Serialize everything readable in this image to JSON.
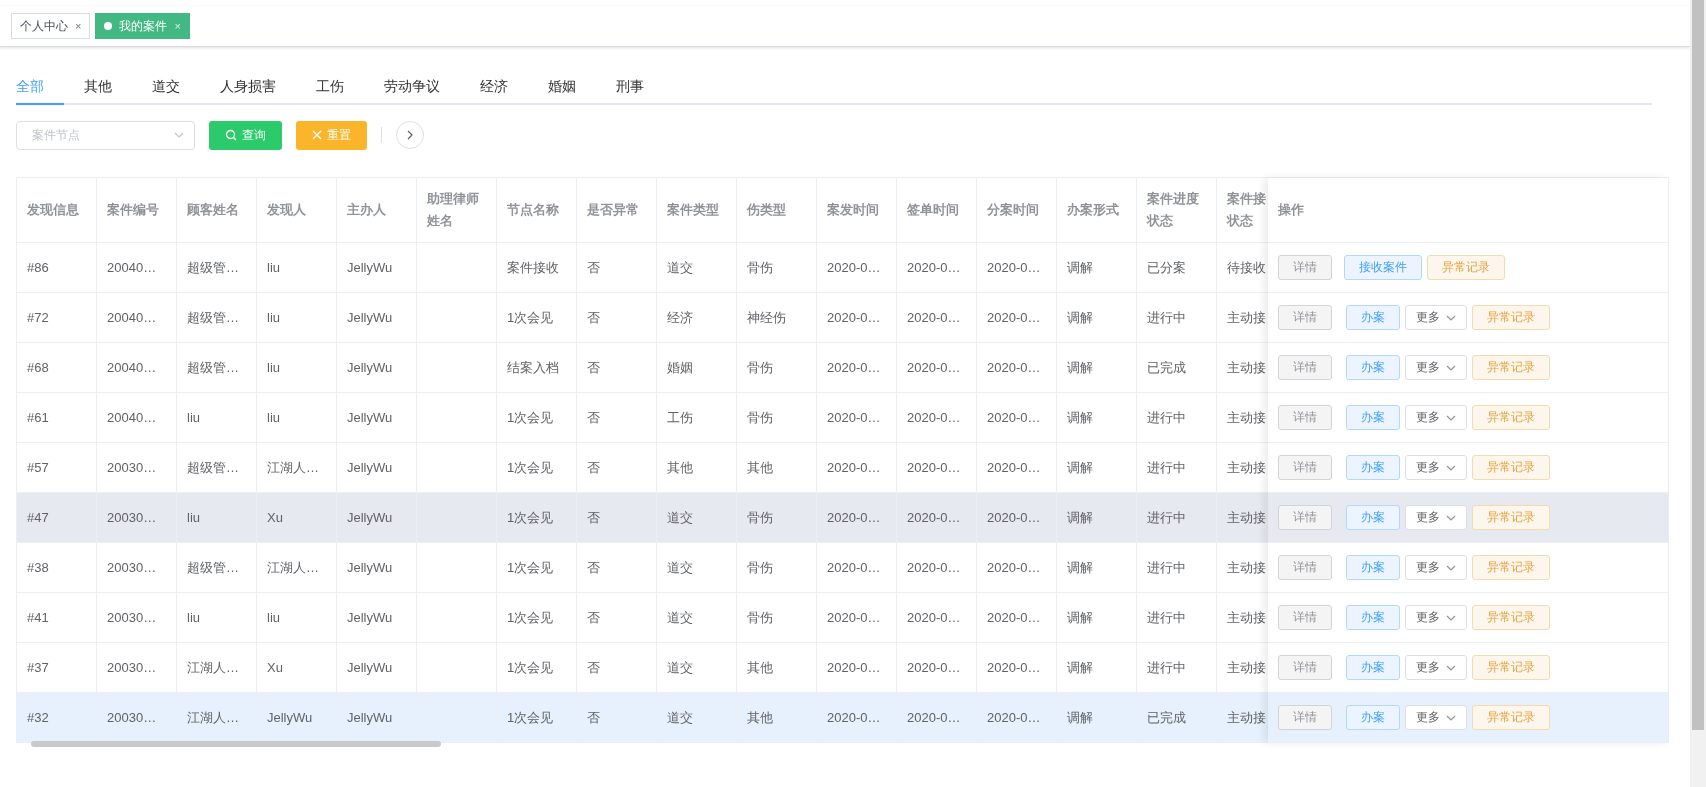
{
  "page_tags": [
    {
      "label": "个人中心",
      "close": "×",
      "selected": false
    },
    {
      "label": "我的案件",
      "close": "×",
      "selected": true
    }
  ],
  "category_tabs": [
    {
      "label": "全部",
      "selected": true
    },
    {
      "label": "其他",
      "selected": false
    },
    {
      "label": "道交",
      "selected": false
    },
    {
      "label": "人身损害",
      "selected": false
    },
    {
      "label": "工伤",
      "selected": false
    },
    {
      "label": "劳动争议",
      "selected": false
    },
    {
      "label": "经济",
      "selected": false
    },
    {
      "label": "婚姻",
      "selected": false
    },
    {
      "label": "刑事",
      "selected": false
    }
  ],
  "filter": {
    "placeholder": "案件节点",
    "query_button": "查询",
    "reset_button": "重置"
  },
  "table": {
    "columns": [
      "发现信息",
      "案件编号",
      "顾客姓名",
      "发现人",
      "主办人",
      "助理律师姓名",
      "节点名称",
      "是否异常",
      "案件类型",
      "伤类型",
      "案发时间",
      "签单时间",
      "分案时间",
      "办案形式",
      "案件进度状态",
      [
        "案件接",
        "状态"
      ]
    ],
    "actions_column": "操作",
    "rows": [
      {
        "cells": [
          "#86",
          "20040…",
          "超级管…",
          "liu",
          "JellyWu",
          "",
          "案件接收",
          "否",
          "道交",
          "骨伤",
          "2020-0…",
          "2020-0…",
          "2020-0…",
          "调解",
          "已分案",
          "待接收"
        ],
        "selected": false,
        "hovered": false,
        "actions": [
          {
            "kind": "default",
            "label": "详情"
          },
          {
            "kind": "primary",
            "label": "接收案件"
          },
          {
            "kind": "warning",
            "label": "异常记录"
          }
        ]
      },
      {
        "cells": [
          "#72",
          "20040…",
          "超级管…",
          "liu",
          "JellyWu",
          "",
          "1次会见",
          "否",
          "经济",
          "神经伤",
          "2020-0…",
          "2020-0…",
          "2020-0…",
          "调解",
          "进行中",
          "主动接"
        ],
        "selected": false,
        "hovered": false,
        "actions": [
          {
            "kind": "default",
            "label": "详情"
          },
          {
            "kind": "primary",
            "label": "办案"
          },
          {
            "kind": "dropdown",
            "label": "更多"
          },
          {
            "kind": "warning",
            "label": "异常记录"
          }
        ]
      },
      {
        "cells": [
          "#68",
          "20040…",
          "超级管…",
          "liu",
          "JellyWu",
          "",
          "结案入档",
          "否",
          "婚姻",
          "骨伤",
          "2020-0…",
          "2020-0…",
          "2020-0…",
          "调解",
          "已完成",
          "主动接"
        ],
        "selected": false,
        "hovered": false,
        "actions": [
          {
            "kind": "default",
            "label": "详情"
          },
          {
            "kind": "primary",
            "label": "办案"
          },
          {
            "kind": "dropdown",
            "label": "更多"
          },
          {
            "kind": "warning",
            "label": "异常记录"
          }
        ]
      },
      {
        "cells": [
          "#61",
          "20040…",
          "liu",
          "liu",
          "JellyWu",
          "",
          "1次会见",
          "否",
          "工伤",
          "骨伤",
          "2020-0…",
          "2020-0…",
          "2020-0…",
          "调解",
          "进行中",
          "主动接"
        ],
        "selected": false,
        "hovered": false,
        "actions": [
          {
            "kind": "default",
            "label": "详情"
          },
          {
            "kind": "primary",
            "label": "办案"
          },
          {
            "kind": "dropdown",
            "label": "更多"
          },
          {
            "kind": "warning",
            "label": "异常记录"
          }
        ]
      },
      {
        "cells": [
          "#57",
          "20030…",
          "超级管…",
          "江湖人…",
          "JellyWu",
          "",
          "1次会见",
          "否",
          "其他",
          "其他",
          "2020-0…",
          "2020-0…",
          "2020-0…",
          "调解",
          "进行中",
          "主动接"
        ],
        "selected": false,
        "hovered": false,
        "actions": [
          {
            "kind": "default",
            "label": "详情"
          },
          {
            "kind": "primary",
            "label": "办案"
          },
          {
            "kind": "dropdown",
            "label": "更多"
          },
          {
            "kind": "warning",
            "label": "异常记录"
          }
        ]
      },
      {
        "cells": [
          "#47",
          "20030…",
          "liu",
          "Xu",
          "JellyWu",
          "",
          "1次会见",
          "否",
          "道交",
          "骨伤",
          "2020-0…",
          "2020-0…",
          "2020-0…",
          "调解",
          "进行中",
          "主动接"
        ],
        "selected": false,
        "hovered": true,
        "actions": [
          {
            "kind": "default",
            "label": "详情"
          },
          {
            "kind": "primary",
            "label": "办案"
          },
          {
            "kind": "dropdown",
            "label": "更多"
          },
          {
            "kind": "warning",
            "label": "异常记录"
          }
        ]
      },
      {
        "cells": [
          "#38",
          "20030…",
          "超级管…",
          "江湖人…",
          "JellyWu",
          "",
          "1次会见",
          "否",
          "道交",
          "骨伤",
          "2020-0…",
          "2020-0…",
          "2020-0…",
          "调解",
          "进行中",
          "主动接"
        ],
        "selected": false,
        "hovered": false,
        "actions": [
          {
            "kind": "default",
            "label": "详情"
          },
          {
            "kind": "primary",
            "label": "办案"
          },
          {
            "kind": "dropdown",
            "label": "更多"
          },
          {
            "kind": "warning",
            "label": "异常记录"
          }
        ]
      },
      {
        "cells": [
          "#41",
          "20030…",
          "liu",
          "liu",
          "JellyWu",
          "",
          "1次会见",
          "否",
          "道交",
          "骨伤",
          "2020-0…",
          "2020-0…",
          "2020-0…",
          "调解",
          "进行中",
          "主动接"
        ],
        "selected": false,
        "hovered": false,
        "actions": [
          {
            "kind": "default",
            "label": "详情"
          },
          {
            "kind": "primary",
            "label": "办案"
          },
          {
            "kind": "dropdown",
            "label": "更多"
          },
          {
            "kind": "warning",
            "label": "异常记录"
          }
        ]
      },
      {
        "cells": [
          "#37",
          "20030…",
          "江湖人…",
          "Xu",
          "JellyWu",
          "",
          "1次会见",
          "否",
          "道交",
          "其他",
          "2020-0…",
          "2020-0…",
          "2020-0…",
          "调解",
          "进行中",
          "主动接"
        ],
        "selected": false,
        "hovered": false,
        "actions": [
          {
            "kind": "default",
            "label": "详情"
          },
          {
            "kind": "primary",
            "label": "办案"
          },
          {
            "kind": "dropdown",
            "label": "更多"
          },
          {
            "kind": "warning",
            "label": "异常记录"
          }
        ]
      },
      {
        "cells": [
          "#32",
          "20030…",
          "江湖人…",
          "JellyWu",
          "JellyWu",
          "",
          "1次会见",
          "否",
          "道交",
          "其他",
          "2020-0…",
          "2020-0…",
          "2020-0…",
          "调解",
          "已完成",
          "主动接"
        ],
        "selected": true,
        "hovered": false,
        "actions": [
          {
            "kind": "default",
            "label": "详情"
          },
          {
            "kind": "primary",
            "label": "办案"
          },
          {
            "kind": "dropdown",
            "label": "更多"
          },
          {
            "kind": "warning",
            "label": "异常记录"
          }
        ]
      }
    ]
  }
}
